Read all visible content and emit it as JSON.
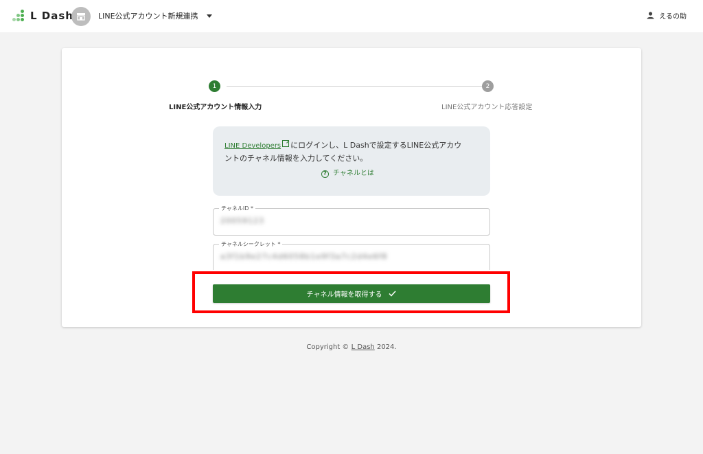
{
  "header": {
    "logo_text": "L Dash",
    "account_selector_label": "LINE公式アカウント新規連携",
    "user_name": "えるの助",
    "brand_color": "#4caf50"
  },
  "stepper": {
    "steps": [
      {
        "number": "1",
        "label": "LINE公式アカウント情報入力",
        "active": true
      },
      {
        "number": "2",
        "label": "LINE公式アカウント応答設定",
        "active": false
      }
    ],
    "active_color": "#2e7d32",
    "inactive_color": "#9e9e9e"
  },
  "info_box": {
    "link_text": "LINE Developers",
    "text_line1": "にログインし、L Dashで設定するLINE公式アカウ",
    "text_line2": "ントのチャネル情報を入力してください。",
    "help_link": "チャネルとは"
  },
  "form": {
    "channel_id_label": "チャネルID *",
    "channel_id_value": "20059123",
    "channel_secret_label": "チャネルシークレット *",
    "channel_secret_value": "a3f1b9e27c4d6058b1e9f3a7c2d4e6f8",
    "submit_label": "チャネル情報を取得する"
  },
  "footer": {
    "prefix": "Copyright ©",
    "brand": "L Dash",
    "suffix": "2024."
  },
  "annotation": {
    "highlight_color": "#ff0000"
  }
}
